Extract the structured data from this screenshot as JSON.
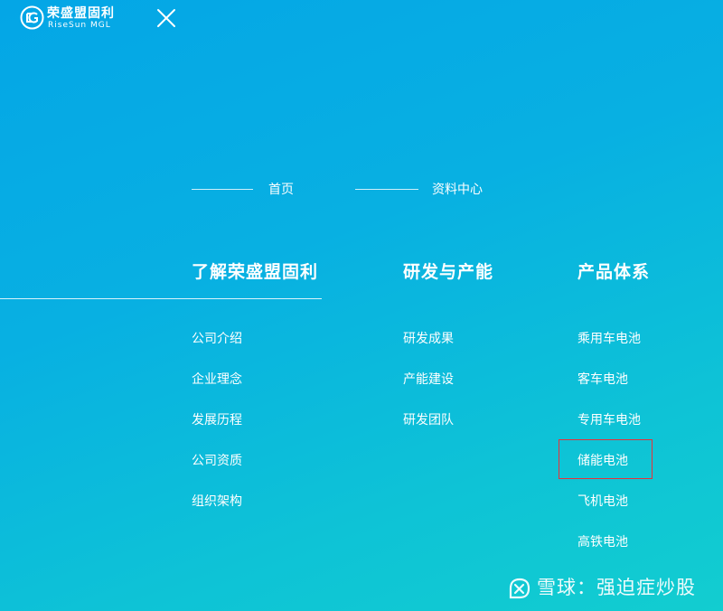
{
  "brand": {
    "name_cn": "荣盛盟固利",
    "name_en": "RiseSun MGL"
  },
  "top_nav": [
    {
      "label": "首页"
    },
    {
      "label": "资料中心"
    }
  ],
  "columns": [
    {
      "title": "了解荣盛盟固利",
      "items": [
        "公司介绍",
        "企业理念",
        "发展历程",
        "公司资质",
        "组织架构"
      ]
    },
    {
      "title": "研发与产能",
      "items": [
        "研发成果",
        "产能建设",
        "研发团队"
      ]
    },
    {
      "title": "产品体系",
      "items": [
        "乘用车电池",
        "客车电池",
        "专用车电池",
        "储能电池",
        "飞机电池",
        "高铁电池"
      ]
    }
  ],
  "watermark": {
    "text": "雪球：强迫症炒股"
  },
  "colors": {
    "bg_start": "#04a6e6",
    "bg_end": "#12cdd0",
    "text": "#ffffff",
    "highlight_border": "#e8313a"
  },
  "icons": {
    "close": "close-icon",
    "logo": "logo-mark-icon",
    "watermark": "snowball-icon"
  }
}
